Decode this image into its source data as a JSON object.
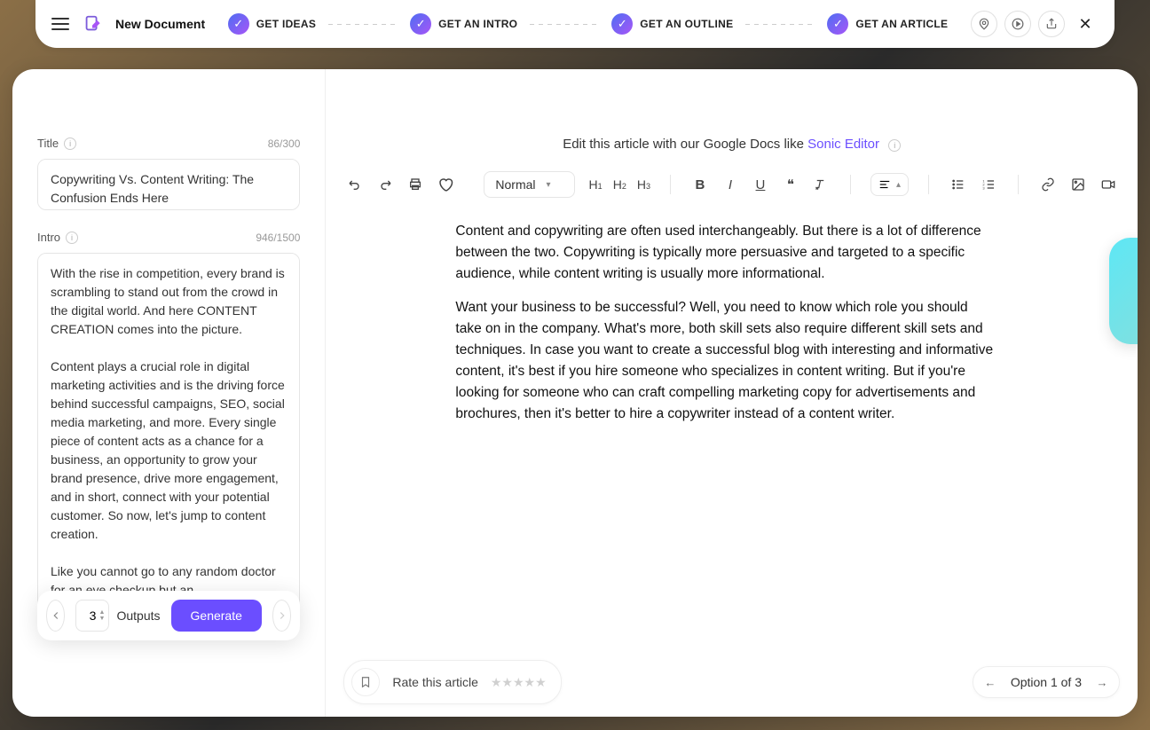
{
  "header": {
    "doc_title": "New Document",
    "steps": [
      "GET IDEAS",
      "GET AN INTRO",
      "GET AN OUTLINE",
      "GET AN ARTICLE"
    ]
  },
  "left": {
    "title_label": "Title",
    "title_count": "86/300",
    "title_value": "Copywriting Vs. Content Writing: The Confusion Ends Here",
    "intro_label": "Intro",
    "intro_count": "946/1500",
    "intro_value": "With the rise in competition, every brand is scrambling to stand out from the crowd in the digital world. And here CONTENT CREATION comes into the picture.\n\nContent plays a crucial role in digital marketing activities and is the driving force behind successful campaigns, SEO, social media marketing, and more. Every single piece of content acts as a chance for a business, an opportunity to grow your brand presence, drive more engagement, and in short, connect with your potential customer. So now, let's jump to content creation.\n\nLike you cannot go to any random doctor for an eye checkup but an ophthalmologist, you cannot go to any writer for writing a compelling piece of copy. So if you are looking to promote your business online, you should learn the nuances that distinguish content writing from copywriting.",
    "outputs_num": "3",
    "outputs_label": "Outputs",
    "generate_label": "Generate"
  },
  "editor": {
    "prompt_prefix": "Edit this article with our Google Docs like ",
    "prompt_link": "Sonic Editor",
    "style_select": "Normal",
    "article_p1": "Content and copywriting are often used interchangeably. But there is a lot of difference between the two. Copywriting is typically more persuasive and targeted to a specific audience, while content writing is usually more informational.",
    "article_p2": "Want your business to be successful? Well, you need to know which role you should take on in the company. What's more, both skill sets also require different skill sets and techniques. In case you want to create a successful blog with interesting and informative content, it's best if you hire someone who specializes in content writing. But if you're looking for someone who can craft compelling marketing copy for advertisements and brochures, then it's better to hire a copywriter instead of a content writer."
  },
  "footer": {
    "rate_label": "Rate this article",
    "option_label": "Option 1 of 3"
  }
}
